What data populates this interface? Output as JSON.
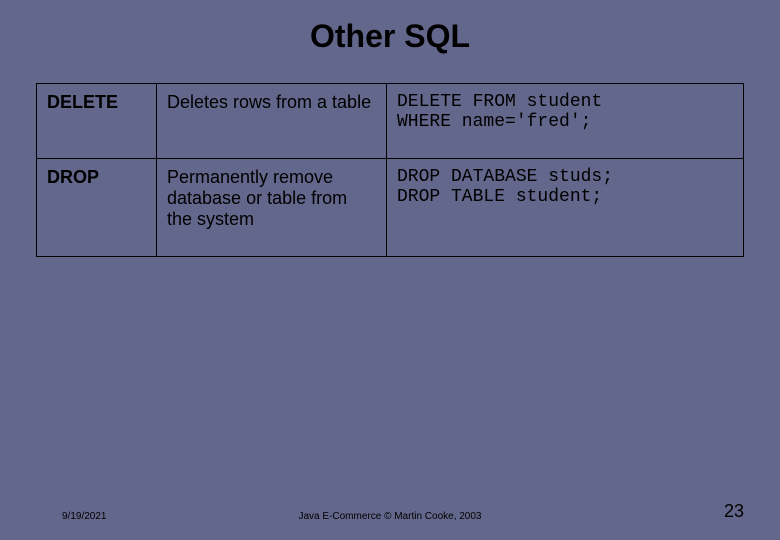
{
  "title": "Other SQL",
  "table": {
    "rows": [
      {
        "command": "DELETE",
        "description": "Deletes rows from a table",
        "example1": "DELETE FROM student",
        "example2": "WHERE name='fred';"
      },
      {
        "command": "DROP",
        "description": "Permanently remove database or table from the system",
        "example1": "DROP DATABASE studs;",
        "example2": "DROP TABLE student;"
      }
    ]
  },
  "footer": {
    "date": "9/19/2021",
    "center": "Java E-Commerce © Martin Cooke, 2003",
    "page": "23"
  }
}
